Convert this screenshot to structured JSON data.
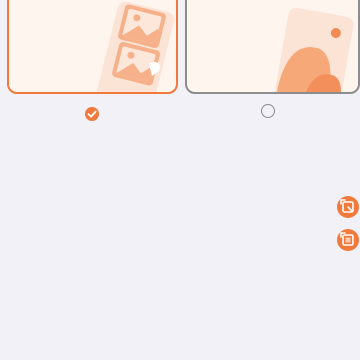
{
  "screen": {
    "background_color": "#f1f1f7",
    "accent_color": "#f07a3c",
    "neutral_border_color": "#8d8d8d"
  },
  "layout_options": [
    {
      "id": "multiple-images",
      "illustration": "stacked-photos-illustration",
      "selected": true
    },
    {
      "id": "single-image",
      "illustration": "single-photo-illustration",
      "selected": false
    }
  ],
  "floating_actions": [
    {
      "icon": "crop-select-icon"
    },
    {
      "icon": "crop-frame-icon"
    }
  ]
}
